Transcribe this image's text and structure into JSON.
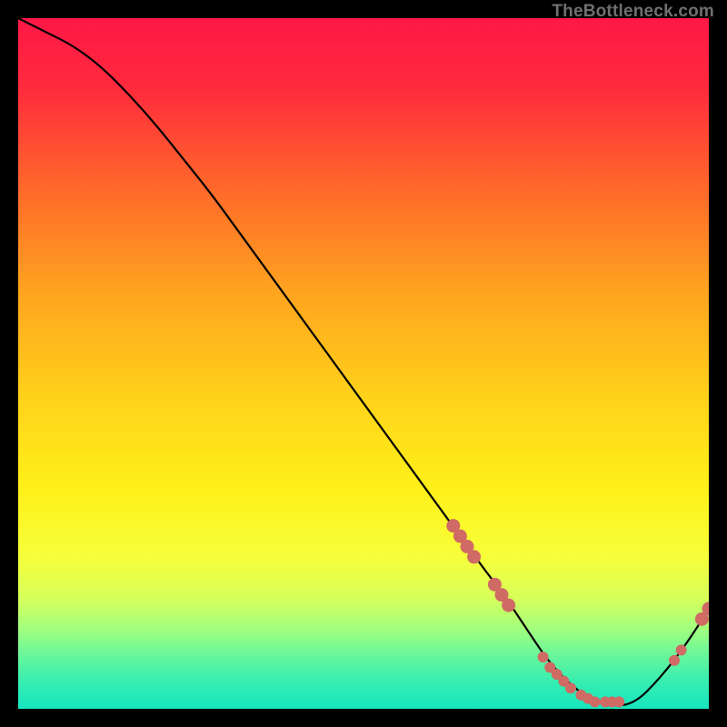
{
  "attribution": "TheBottleneck.com",
  "colors": {
    "curve": "#000000",
    "marker": "#cf6a64",
    "gradient_top": "#ff1846",
    "gradient_mid": "#ffe81a",
    "gradient_bottom": "#16e6c0"
  },
  "chart_data": {
    "type": "line",
    "title": "",
    "xlabel": "",
    "ylabel": "",
    "xlim": [
      0,
      100
    ],
    "ylim": [
      0,
      100
    ],
    "x": [
      0,
      4,
      8,
      12,
      16,
      20,
      24,
      28,
      32,
      36,
      40,
      44,
      48,
      52,
      56,
      60,
      64,
      68,
      70,
      72,
      74,
      76,
      78,
      80,
      82,
      84,
      86,
      88,
      90,
      92,
      94,
      96,
      98,
      100
    ],
    "y": [
      100,
      98,
      96,
      93,
      89,
      84.5,
      79.5,
      74.5,
      69,
      63.5,
      58,
      52.5,
      47,
      41.5,
      36,
      30.5,
      25,
      19.5,
      17,
      14,
      11,
      8,
      5.5,
      3.5,
      2,
      1,
      0.5,
      0.5,
      1.5,
      3.5,
      5.8,
      8.4,
      11.3,
      14.5
    ],
    "markers": [
      {
        "x": 63,
        "y": 26.5
      },
      {
        "x": 64,
        "y": 25
      },
      {
        "x": 65,
        "y": 23.5
      },
      {
        "x": 66,
        "y": 22
      },
      {
        "x": 69,
        "y": 18
      },
      {
        "x": 70,
        "y": 16.5
      },
      {
        "x": 71,
        "y": 15
      },
      {
        "x": 76,
        "y": 7.5
      },
      {
        "x": 77,
        "y": 6
      },
      {
        "x": 78,
        "y": 5
      },
      {
        "x": 79,
        "y": 4
      },
      {
        "x": 80,
        "y": 3
      },
      {
        "x": 81.5,
        "y": 2
      },
      {
        "x": 82.5,
        "y": 1.5
      },
      {
        "x": 83.5,
        "y": 1
      },
      {
        "x": 85,
        "y": 1
      },
      {
        "x": 86,
        "y": 1
      },
      {
        "x": 87,
        "y": 1
      },
      {
        "x": 95,
        "y": 7
      },
      {
        "x": 96,
        "y": 8.5
      },
      {
        "x": 99,
        "y": 13
      },
      {
        "x": 100,
        "y": 14.5
      }
    ],
    "curve_stroke_width": 2.2,
    "marker_radius_big": 7.5,
    "marker_radius_small": 6
  }
}
